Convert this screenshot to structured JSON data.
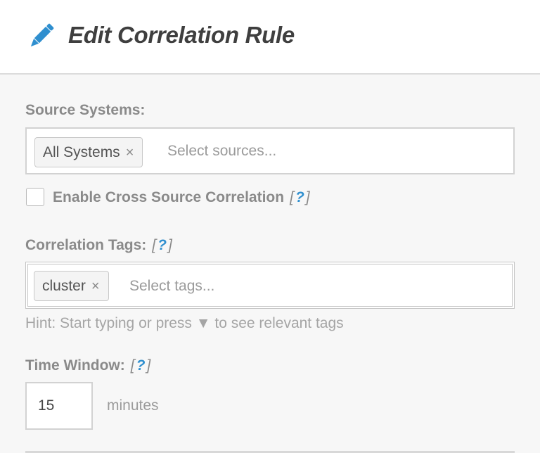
{
  "header": {
    "title": "Edit Correlation Rule",
    "icon": "pencil-icon"
  },
  "source_systems": {
    "label": "Source Systems:",
    "tags": [
      {
        "label": "All Systems",
        "remove": "×"
      }
    ],
    "placeholder": "Select sources..."
  },
  "cross_source": {
    "checked": false,
    "label": "Enable Cross Source Correlation",
    "help_open": "[",
    "help_q": "?",
    "help_close": "]"
  },
  "correlation_tags": {
    "label": "Correlation Tags:",
    "help_open": "[",
    "help_q": "?",
    "help_close": "]",
    "tags": [
      {
        "label": "cluster",
        "remove": "×"
      }
    ],
    "placeholder": "Select tags...",
    "hint": "Hint: Start typing or press ▼ to see relevant tags"
  },
  "time_window": {
    "label": "Time Window:",
    "help_open": "[",
    "help_q": "?",
    "help_close": "]",
    "value": "15",
    "unit": "minutes"
  },
  "colors": {
    "accent": "#2f8fcf",
    "title": "#3f3f3f",
    "label": "#8a8a8a"
  }
}
